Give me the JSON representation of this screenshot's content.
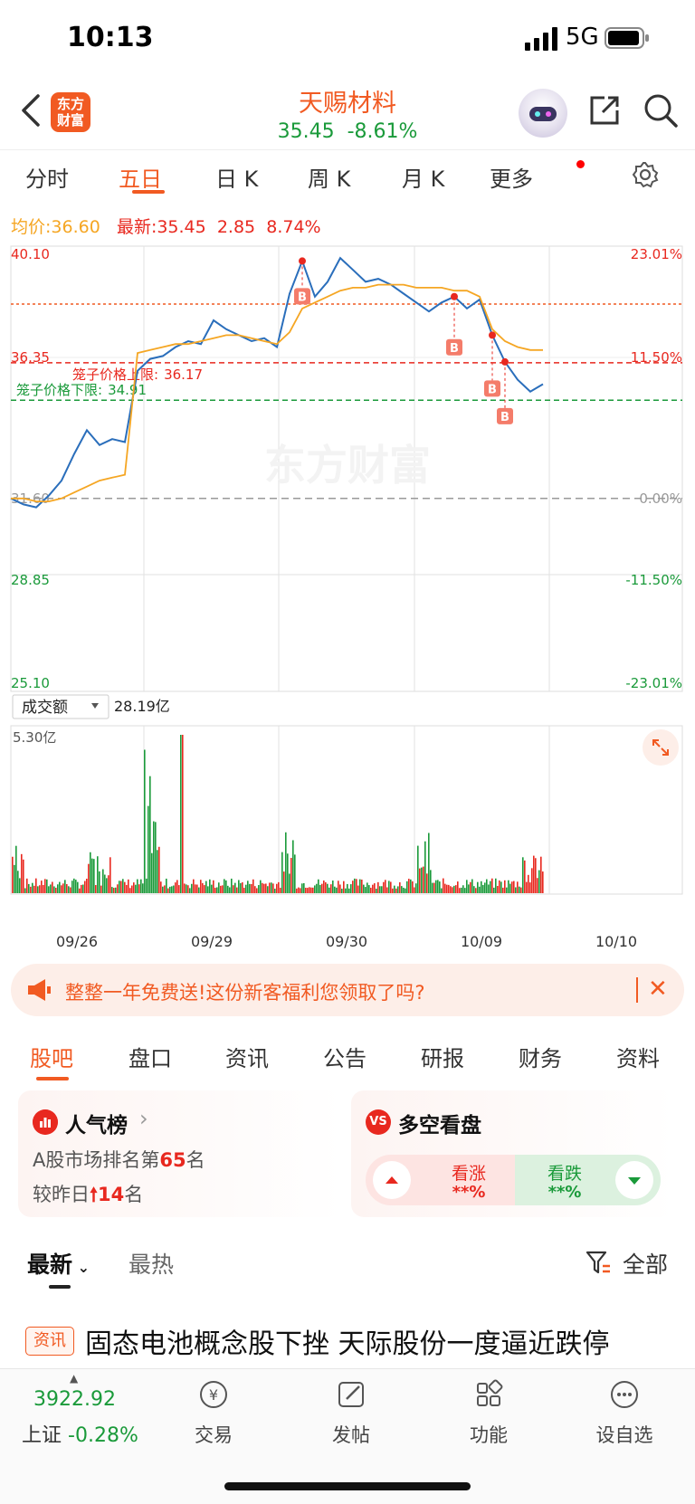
{
  "status": {
    "time": "10:13",
    "network": "5G"
  },
  "header": {
    "logo_line1": "东方",
    "logo_line2": "财富",
    "stock_name": "天赐材料",
    "price": "35.45",
    "change_pct": "-8.61%"
  },
  "tabs": [
    "分时",
    "五日",
    "日 K",
    "周 K",
    "月 K",
    "更多"
  ],
  "active_tab": "五日",
  "info": {
    "avg_label": "均价:",
    "avg_value": "36.60",
    "latest_label": "最新:",
    "latest_value": "35.45",
    "latest_change": "2.85",
    "latest_change_pct": "8.74%"
  },
  "chart": {
    "watermark": "东方财富",
    "y_left": [
      "40.10",
      "36.35",
      "31.60",
      "28.85",
      "25.10"
    ],
    "y_right": [
      "23.01%",
      "11.50%",
      "0.00%",
      "-11.50%",
      "-23.01%"
    ],
    "cage_upper_label": "笼子价格上限:",
    "cage_upper_value": "36.17",
    "cage_lower_label": "笼子价格下限:",
    "cage_lower_value": "34.91",
    "marker_label": "B",
    "volume_selector": "成交额",
    "volume_total": "28.19亿",
    "volume_max": "5.30亿",
    "dates": [
      "09/26",
      "09/29",
      "09/30",
      "10/09",
      "10/10"
    ]
  },
  "chart_data": {
    "type": "line",
    "x": [
      "09/26",
      "09/29",
      "09/30",
      "10/09",
      "10/10"
    ],
    "series": [
      {
        "values": [
          31.6,
          31.4,
          31.3,
          31.7,
          32.2,
          33.1,
          33.9,
          33.4,
          33.6,
          33.5,
          35.9,
          36.3,
          36.4,
          36.7,
          36.9,
          36.8,
          37.6,
          37.3,
          37.1,
          36.9,
          37.0,
          36.7,
          38.5,
          39.6,
          38.4,
          38.9,
          39.7,
          39.3,
          38.9,
          39.0,
          38.8,
          38.5,
          38.2,
          37.9,
          38.2,
          38.4,
          38.0,
          38.3,
          37.1,
          36.2,
          35.6,
          35.2,
          35.45
        ]
      },
      {
        "values": [
          31.6,
          31.6,
          31.5,
          31.5,
          31.6,
          31.8,
          32.0,
          32.2,
          32.3,
          32.4,
          36.5,
          36.6,
          36.7,
          36.8,
          36.8,
          36.9,
          37.0,
          37.1,
          37.1,
          37.0,
          36.9,
          36.8,
          37.2,
          38.0,
          38.2,
          38.4,
          38.6,
          38.7,
          38.7,
          38.8,
          38.8,
          38.8,
          38.7,
          38.7,
          38.7,
          38.6,
          38.6,
          38.4,
          37.3,
          36.9,
          36.7,
          36.6,
          36.6
        ]
      }
    ],
    "ylim": [
      25.1,
      40.1
    ],
    "reference_price": 31.6,
    "volume_ylim": [
      0,
      5.3
    ]
  },
  "promo": {
    "text": "整整一年免费送!这份新客福利您领取了吗?"
  },
  "subtabs": [
    "股吧",
    "盘口",
    "资讯",
    "公告",
    "研报",
    "财务",
    "资料"
  ],
  "popularity": {
    "title": "人气榜",
    "rank_prefix": "A股市场排名第",
    "rank_value": "65",
    "rank_suffix": "名",
    "change_prefix": "较昨日",
    "change_value": "14",
    "change_suffix": "名"
  },
  "sentiment": {
    "title": "多空看盘",
    "icon_text": "VS",
    "bull_label": "看涨",
    "bull_value": "**%",
    "bear_label": "看跌",
    "bear_value": "**%"
  },
  "feed_filter": {
    "latest": "最新",
    "hot": "最热",
    "all": "全部"
  },
  "news": {
    "tag": "资讯",
    "title": "固态电池概念股下挫 天际股份一度逼近跌停"
  },
  "bottom": {
    "index_value": "3922.92",
    "index_name": "上证",
    "index_change": "-0.28%",
    "nav": [
      "交易",
      "发帖",
      "功能",
      "设自选"
    ]
  }
}
